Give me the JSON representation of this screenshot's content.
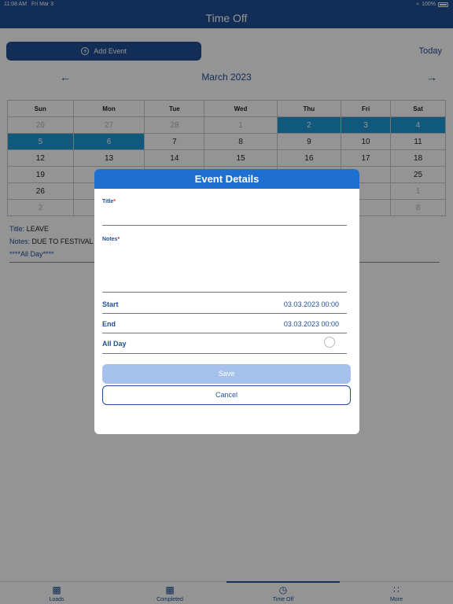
{
  "status": {
    "time": "11:08 AM",
    "date": "Fri Mar 3",
    "battery": "100%"
  },
  "header": {
    "title": "Time Off"
  },
  "toolbar": {
    "add_event_label": "Add Event",
    "today_label": "Today"
  },
  "calendar": {
    "month_title": "March 2023",
    "weekdays": [
      "Sun",
      "Mon",
      "Tue",
      "Wed",
      "Thu",
      "Fri",
      "Sat"
    ],
    "weeks": [
      [
        {
          "d": "26",
          "m": true
        },
        {
          "d": "27",
          "m": true
        },
        {
          "d": "28",
          "m": true
        },
        {
          "d": "1",
          "m": true
        },
        {
          "d": "2",
          "s": true
        },
        {
          "d": "3",
          "s": true
        },
        {
          "d": "4",
          "s": true
        }
      ],
      [
        {
          "d": "5",
          "s": true
        },
        {
          "d": "6",
          "s": true
        },
        {
          "d": "7"
        },
        {
          "d": "8"
        },
        {
          "d": "9"
        },
        {
          "d": "10"
        },
        {
          "d": "11"
        }
      ],
      [
        {
          "d": "12"
        },
        {
          "d": "13"
        },
        {
          "d": "14"
        },
        {
          "d": "15"
        },
        {
          "d": "16"
        },
        {
          "d": "17"
        },
        {
          "d": "18"
        }
      ],
      [
        {
          "d": "19"
        },
        {
          "d": ""
        },
        {
          "d": ""
        },
        {
          "d": ""
        },
        {
          "d": ""
        },
        {
          "d": ""
        },
        {
          "d": "25"
        }
      ],
      [
        {
          "d": "26"
        },
        {
          "d": ""
        },
        {
          "d": ""
        },
        {
          "d": ""
        },
        {
          "d": ""
        },
        {
          "d": ""
        },
        {
          "d": "1",
          "m": true
        }
      ],
      [
        {
          "d": "2",
          "m": true
        },
        {
          "d": ""
        },
        {
          "d": ""
        },
        {
          "d": ""
        },
        {
          "d": ""
        },
        {
          "d": ""
        },
        {
          "d": "8",
          "m": true
        }
      ]
    ]
  },
  "event_info": {
    "title_label": "Title:",
    "title_value": "LEAVE",
    "notes_label": "Notes:",
    "notes_value": "DUE TO FESTIVAL",
    "all_day": "****All Day****"
  },
  "modal": {
    "title": "Event Details",
    "title_label": "Title",
    "notes_label": "Notes",
    "required_mark": "*",
    "start_label": "Start",
    "start_value": "03.03.2023 00:00",
    "end_label": "End",
    "end_value": "03.03.2023 00:00",
    "all_day_label": "All Day",
    "save_label": "Save",
    "cancel_label": "Cancel"
  },
  "tabs": [
    {
      "label": "Loads",
      "icon": "truck-box-icon"
    },
    {
      "label": "Completed",
      "icon": "truck-check-icon"
    },
    {
      "label": "Time Off",
      "icon": "truck-clock-icon",
      "active": true
    },
    {
      "label": "More",
      "icon": "grid-icon"
    }
  ],
  "colors": {
    "primary": "#1f4f95",
    "modal_header": "#1f6fd0",
    "selected_day": "#1c9ad6"
  }
}
